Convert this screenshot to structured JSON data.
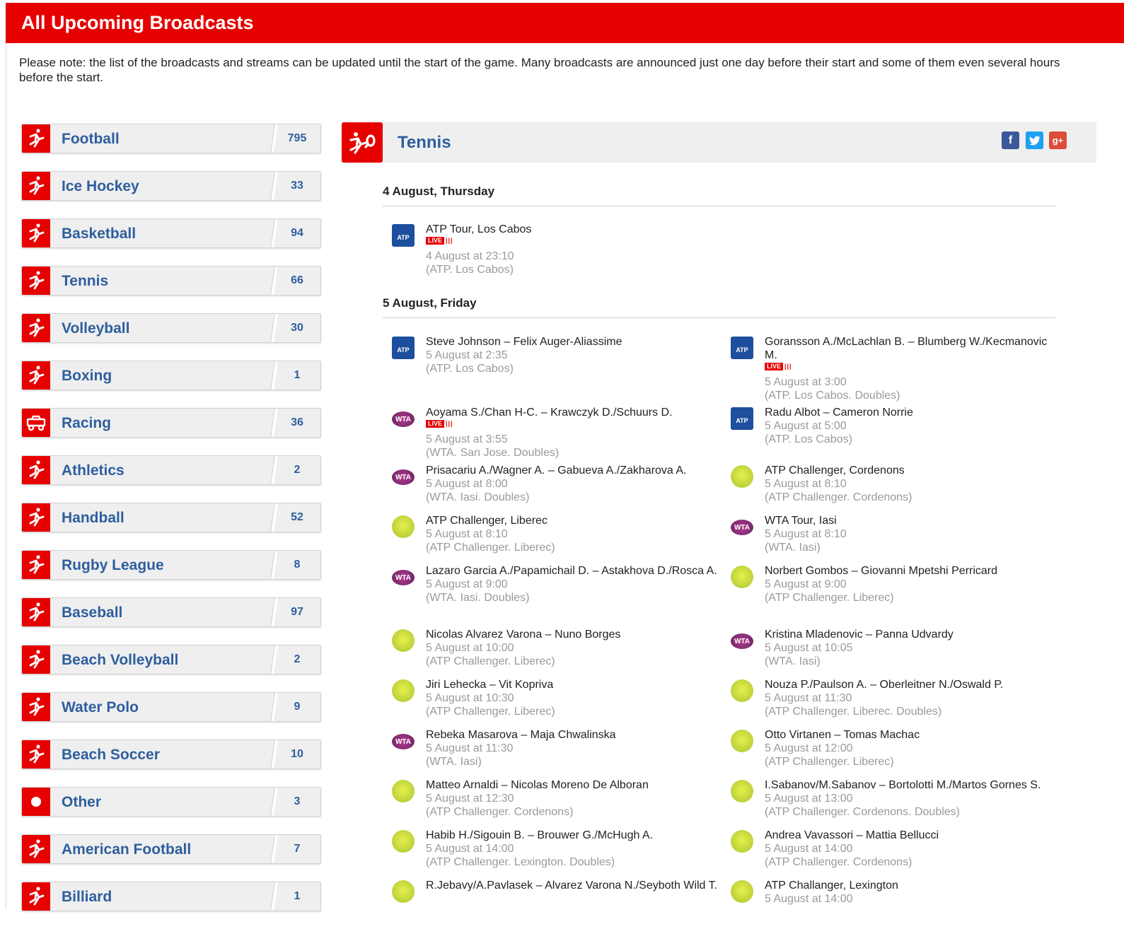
{
  "header": {
    "title": "All Upcoming Broadcasts"
  },
  "note": "Please note: the list of the broadcasts and streams can be updated until the start of the game. Many broadcasts are announced just one day before their start and some of them even several hours before the start.",
  "sports": [
    {
      "name": "Football",
      "count": "795",
      "icon": "football-icon"
    },
    {
      "name": "Ice Hockey",
      "count": "33",
      "icon": "ice-hockey-icon"
    },
    {
      "name": "Basketball",
      "count": "94",
      "icon": "basketball-icon"
    },
    {
      "name": "Tennis",
      "count": "66",
      "icon": "tennis-icon"
    },
    {
      "name": "Volleyball",
      "count": "30",
      "icon": "volleyball-icon"
    },
    {
      "name": "Boxing",
      "count": "1",
      "icon": "boxing-icon"
    },
    {
      "name": "Racing",
      "count": "36",
      "icon": "racing-icon"
    },
    {
      "name": "Athletics",
      "count": "2",
      "icon": "athletics-icon"
    },
    {
      "name": "Handball",
      "count": "52",
      "icon": "handball-icon"
    },
    {
      "name": "Rugby League",
      "count": "8",
      "icon": "rugby-icon"
    },
    {
      "name": "Baseball",
      "count": "97",
      "icon": "baseball-icon"
    },
    {
      "name": "Beach Volleyball",
      "count": "2",
      "icon": "beach-volleyball-icon"
    },
    {
      "name": "Water Polo",
      "count": "9",
      "icon": "water-polo-icon"
    },
    {
      "name": "Beach Soccer",
      "count": "10",
      "icon": "beach-soccer-icon"
    },
    {
      "name": "Other",
      "count": "3",
      "icon": "other-icon"
    },
    {
      "name": "American Football",
      "count": "7",
      "icon": "american-football-icon"
    },
    {
      "name": "Billiard",
      "count": "1",
      "icon": "billiard-icon"
    }
  ],
  "main": {
    "sport_title": "Tennis",
    "live_label": "LIVE",
    "days": [
      {
        "label": "4 August, Thursday"
      },
      {
        "label": "5 August, Friday"
      }
    ],
    "day1_events": [
      {
        "title": "ATP Tour, Los Cabos",
        "time": "4 August at 23:10",
        "source": "(ATP. Los Cabos)",
        "logo": "ATP",
        "live": true
      }
    ],
    "day2_events": [
      {
        "title": "Steve Johnson – Felix Auger-Aliassime",
        "time": "5 August at 2:35",
        "source": "(ATP. Los Cabos)",
        "logo": "ATP",
        "live": false
      },
      {
        "title": "Goransson A./McLachlan B. – Blumberg W./Kecmanovic M.",
        "time": "5 August at 3:00",
        "source": "(ATP. Los Cabos. Doubles)",
        "logo": "ATP",
        "live": true
      },
      {
        "title": "Aoyama S./Chan H-C. – Krawczyk D./Schuurs D.",
        "time": "5 August at 3:55",
        "source": "(WTA. San Jose. Doubles)",
        "logo": "WTA",
        "live": true
      },
      {
        "title": "Radu Albot – Cameron Norrie",
        "time": "5 August at 5:00",
        "source": "(ATP. Los Cabos)",
        "logo": "ATP",
        "live": false
      },
      {
        "title": "Prisacariu A./Wagner A. – Gabueva A./Zakharova A.",
        "time": "5 August at 8:00",
        "source": "(WTA. Iasi. Doubles)",
        "logo": "WTA",
        "live": false
      },
      {
        "title": "ATP Challenger, Cordenons",
        "time": "5 August at 8:10",
        "source": "(ATP Challenger. Cordenons)",
        "logo": "CH",
        "live": false
      },
      {
        "title": "ATP Challenger, Liberec",
        "time": "5 August at 8:10",
        "source": "(ATP Challenger. Liberec)",
        "logo": "CH",
        "live": false
      },
      {
        "title": "WTA Tour, Iasi",
        "time": "5 August at 8:10",
        "source": "(WTA. Iasi)",
        "logo": "WTA",
        "live": false
      },
      {
        "title": "Lazaro Garcia A./Papamichail D. – Astakhova D./Rosca A.",
        "time": "5 August at 9:00",
        "source": "(WTA. Iasi. Doubles)",
        "logo": "WTA",
        "live": false
      },
      {
        "title": "Norbert Gombos – Giovanni Mpetshi Perricard",
        "time": "5 August at 9:00",
        "source": "(ATP Challenger. Liberec)",
        "logo": "CH",
        "live": false
      },
      {
        "title": "Nicolas Alvarez Varona – Nuno Borges",
        "time": "5 August at 10:00",
        "source": "(ATP Challenger. Liberec)",
        "logo": "CH",
        "live": false
      },
      {
        "title": "Kristina Mladenovic – Panna Udvardy",
        "time": "5 August at 10:05",
        "source": "(WTA. Iasi)",
        "logo": "WTA",
        "live": false
      },
      {
        "title": "Jiri Lehecka – Vit Kopriva",
        "time": "5 August at 10:30",
        "source": "(ATP Challenger. Liberec)",
        "logo": "CH",
        "live": false
      },
      {
        "title": "Nouza P./Paulson A. – Oberleitner N./Oswald P.",
        "time": "5 August at 11:30",
        "source": "(ATP Challenger. Liberec. Doubles)",
        "logo": "CH",
        "live": false
      },
      {
        "title": "Rebeka Masarova – Maja Chwalinska",
        "time": "5 August at 11:30",
        "source": "(WTA. Iasi)",
        "logo": "WTA",
        "live": false
      },
      {
        "title": "Otto Virtanen – Tomas Machac",
        "time": "5 August at 12:00",
        "source": "(ATP Challenger. Liberec)",
        "logo": "CH",
        "live": false
      },
      {
        "title": "Matteo Arnaldi – Nicolas Moreno De Alboran",
        "time": "5 August at 12:30",
        "source": "(ATP Challenger. Cordenons)",
        "logo": "CH",
        "live": false
      },
      {
        "title": "I.Sabanov/M.Sabanov – Bortolotti M./Martos Gornes S.",
        "time": "5 August at 13:00",
        "source": "(ATP Challenger. Cordenons. Doubles)",
        "logo": "CH",
        "live": false
      },
      {
        "title": "Habib H./Sigouin B. – Brouwer G./McHugh A.",
        "time": "5 August at 14:00",
        "source": "(ATP Challenger. Lexington. Doubles)",
        "logo": "CH",
        "live": false
      },
      {
        "title": "Andrea Vavassori – Mattia Bellucci",
        "time": "5 August at 14:00",
        "source": "(ATP Challenger. Cordenons)",
        "logo": "CH",
        "live": false
      },
      {
        "title": "R.Jebavy/A.Pavlasek – Alvarez Varona N./Seyboth Wild T.",
        "time": "",
        "source": "",
        "logo": "CH",
        "live": false
      },
      {
        "title": "ATP Challanger, Lexington",
        "time": "5 August at 14:00",
        "source": "",
        "logo": "CH",
        "live": false
      }
    ]
  },
  "colors": {
    "brand_red": "#e60000",
    "link_blue": "#2e5e9e",
    "muted_gray": "#9a9a9a"
  }
}
